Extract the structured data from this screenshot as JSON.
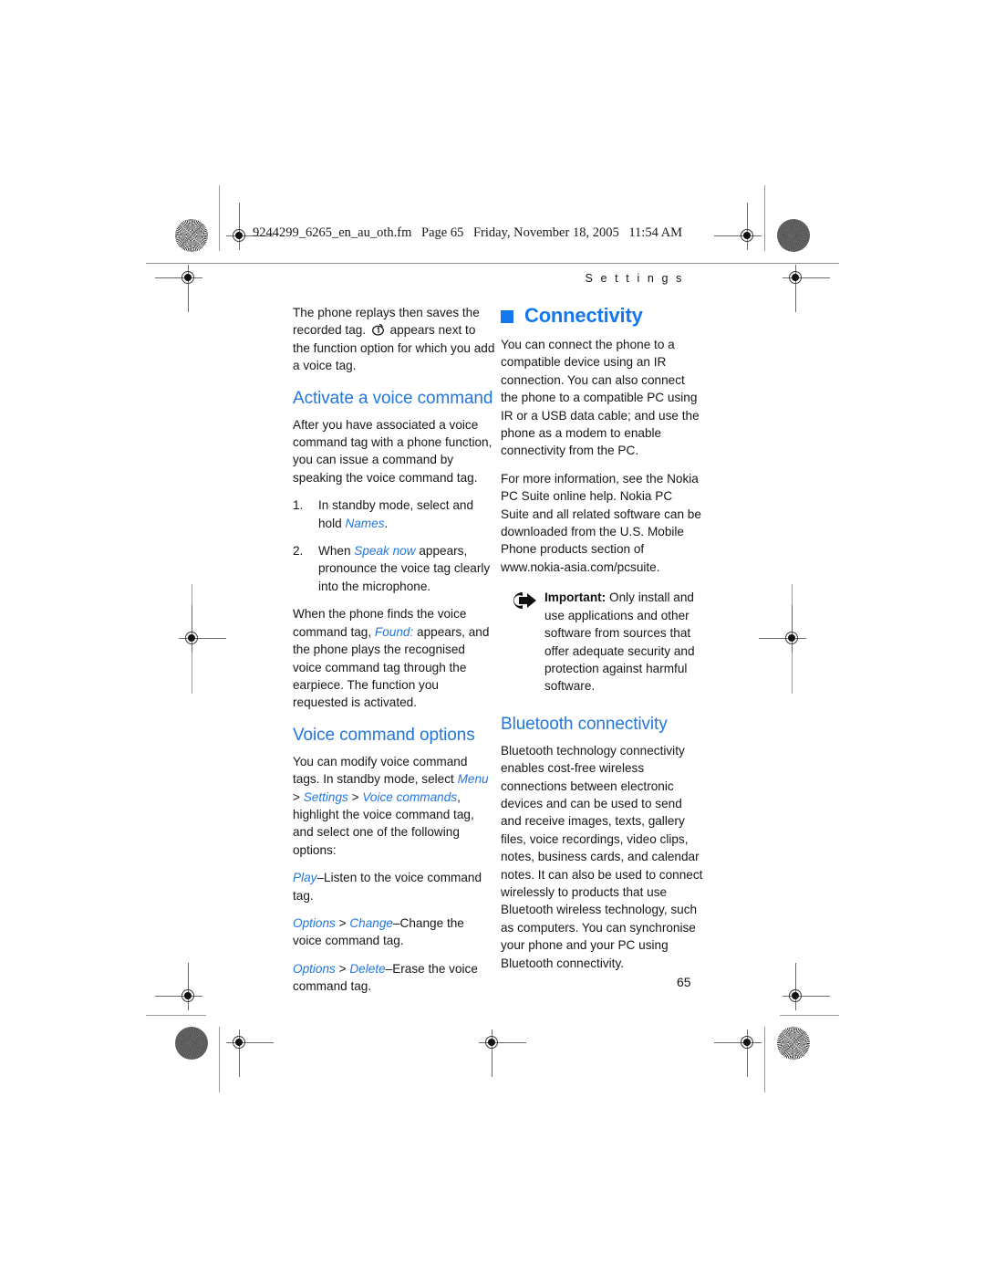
{
  "document": {
    "slug": {
      "filename": "9244299_6265_en_au_oth.fm",
      "page_label": "Page 65",
      "date": "Friday, November 18, 2005",
      "time": "11:54 AM"
    },
    "running_head": "S e t t i n g s",
    "page_number": "65",
    "accent_blue": "#2277DD",
    "heading_blue": "#1577EE"
  },
  "left_column": {
    "intro_paragraph": {
      "part1": "The phone replays then saves the recorded tag.",
      "icon": "voice-tag-icon",
      "part2": "appears next to the function option for which you add a voice tag."
    },
    "activate_heading": "Activate a voice command",
    "activate_paragraph": "After you have associated a voice command tag with a phone function, you can issue a command by speaking the voice command tag.",
    "steps": [
      {
        "num": "1.",
        "text_before": "In standby mode, select and hold ",
        "term": "Names",
        "text_after": "."
      },
      {
        "num": "2.",
        "text_before": "When ",
        "term": "Speak now",
        "text_after": " appears, pronounce the voice tag clearly into the microphone."
      }
    ],
    "found_paragraph": {
      "part1": "When the phone finds the voice command tag, ",
      "term": "Found:",
      "part2": " appears, and the phone plays the recognised voice command tag through the earpiece. The function you requested is activated."
    },
    "options_heading": "Voice command options",
    "options_intro": {
      "part1": "You can modify voice command tags. In standby mode, select ",
      "term1": "Menu",
      "sep1": " > ",
      "term2": "Settings",
      "sep2": " > ",
      "term3": "Voice commands",
      "part2": ", highlight the voice command tag, and select one of the following options:"
    },
    "option_items": [
      {
        "term1": "Play",
        "sep": "",
        "term2": "",
        "desc": "–Listen to the voice command tag."
      },
      {
        "term1": "Options",
        "sep": " > ",
        "term2": "Change",
        "desc": "–Change the voice command tag."
      },
      {
        "term1": "Options",
        "sep": " > ",
        "term2": "Delete",
        "desc": "–Erase the voice command tag."
      }
    ]
  },
  "right_column": {
    "section_title": "Connectivity",
    "section_bullet": "blue-square-bullet",
    "paragraph_1": "You can connect the phone to a compatible device using an IR connection. You can also connect the phone to a compatible PC using IR or a USB data cable; and use the phone as a modem to enable connectivity from the PC.",
    "paragraph_2": "For more information, see the Nokia PC Suite online help. Nokia PC Suite and all related software can be downloaded from the U.S. Mobile Phone products section of www.nokia-asia.com/pcsuite.",
    "note": {
      "icon": "important-arrow-icon",
      "label": "Important:",
      "text": " Only install and use applications and other software from sources that offer adequate security and protection against harmful software."
    },
    "bluetooth_heading": "Bluetooth connectivity",
    "bluetooth_paragraph": "Bluetooth technology connectivity enables cost-free wireless connections between electronic devices and can be used to send and receive images, texts, gallery files, voice recordings, video clips, notes, business cards, and calendar notes. It can also be used to connect wirelessly to products that use Bluetooth wireless technology, such as computers. You can synchronise your phone and your PC using Bluetooth connectivity."
  }
}
